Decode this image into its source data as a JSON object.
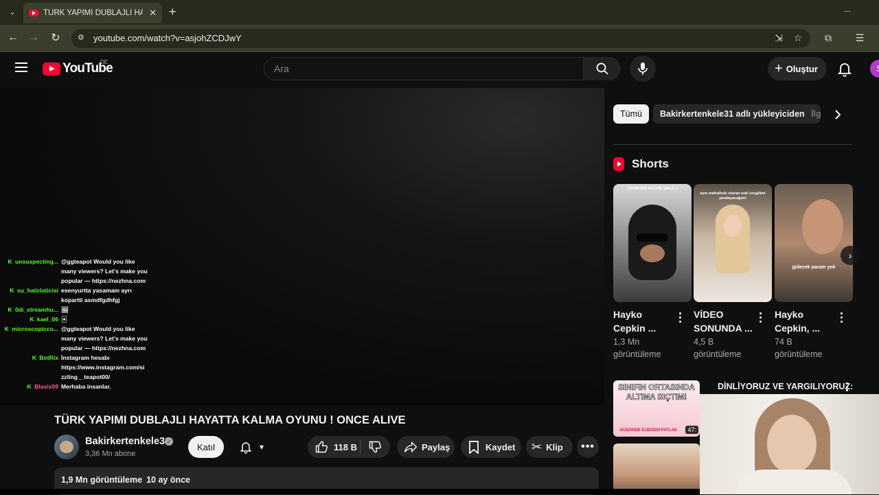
{
  "browser": {
    "tab_title": "TÜRK YAPIMI DUBLAJLI HAYATTA KALMA OYUNU ! ONCE ALIVE",
    "url": "youtube.com/watch?v=asjohZCDJwY"
  },
  "masthead": {
    "logo_text": "YouTube",
    "country_code": "DE",
    "search_placeholder": "Ara",
    "create_label": "Oluştur",
    "avatar_letter": "S"
  },
  "chat": [
    {
      "user": "unsuspecting...",
      "user_color": "#53fc18",
      "badge": true,
      "lines": [
        "@ggteapot Would you like",
        "many viewers? Let's make you",
        "popular — https://nezhna.com"
      ]
    },
    {
      "user": "su_hatirlaticisi",
      "user_color": "#53fc18",
      "badge": true,
      "lines": [
        "esenyurtta yasamam ayrı",
        "kopartti asmdfgdhfgj"
      ]
    },
    {
      "user": "0di_streamhu...",
      "user_color": "#53fc18",
      "badge": true,
      "lines": [
        "🖼"
      ]
    },
    {
      "user": "kael_06",
      "user_color": "#53fc18",
      "badge": true,
      "lines": [
        "🃏"
      ]
    },
    {
      "user": "microscopicco...",
      "user_color": "#53fc18",
      "badge": true,
      "lines": [
        "@ggteapot Would you like",
        "many viewers? Let's make you",
        "popular — https://nezhna.com"
      ]
    },
    {
      "user": "BotRix",
      "user_color": "#53fc18",
      "badge": true,
      "lines": [
        "İnstagram hesabı",
        "https://www.instagram.com/si",
        "zzling__teapot00/"
      ]
    },
    {
      "user": "Blaxis09",
      "user_color": "#ff5c9a",
      "badge": true,
      "lines": [
        "Merhaba insanlar."
      ]
    }
  ],
  "video": {
    "title": "TÜRK YAPIMI DUBLAJLI HAYATTA KALMA OYUNU ! ONCE ALIVE",
    "channel": "Bakirkertenkele31",
    "subscribers": "3,36 Mn abone",
    "join_label": "Katıl",
    "likes": "118 B",
    "share_label": "Paylaş",
    "save_label": "Kaydet",
    "clip_label": "Klip",
    "views": "1,9 Mn görüntüleme",
    "age": "10 ay önce"
  },
  "sidebar": {
    "chips": [
      "Tümü",
      "Bakirkertenkele31 adlı yükleyiciden",
      "İlg"
    ],
    "shorts_label": "Shorts",
    "shorts": [
      {
        "title": "Hayko Cepkin ...",
        "views": "1,3 Mn görüntüleme",
        "caption": "GRUBUNA MÜTHİŞ ŞAKA :)"
      },
      {
        "title": "VİDEO SONUNDA ...",
        "views": "4,5 B görüntüleme",
        "caption": "aynı mahallede oturan eski sevgilimi yaralayacağım!"
      },
      {
        "title": "Hayko Cepkin, ...",
        "views": "74 B görüntüleme",
        "caption": "gidecek param yok"
      }
    ],
    "rec": {
      "thumb_text": "SINIFIN ORTASINDA ALTIMA SIÇTIM!",
      "thumb_subtext": "DÜŞÜNDE ELBİSEM PATLAK",
      "duration": "47:",
      "title": "DİNLİYORUZ VE YARGILIYORUZ:"
    }
  }
}
